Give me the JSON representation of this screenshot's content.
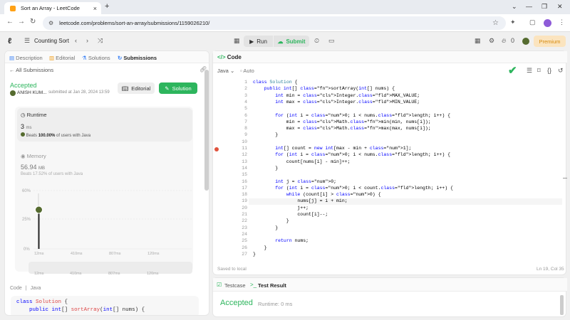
{
  "browser": {
    "tab_title": "Sort an Array - LeetCode",
    "tab_close": "×",
    "new_tab": "+",
    "url": "leetcode.com/problems/sort-an-array/submissions/1159026210/",
    "profile_color": "#8e5bd8"
  },
  "nav": {
    "problem_title": "Counting Sort",
    "run_label": "Run",
    "submit_label": "Submit",
    "coins": "0",
    "premium_label": "Premium"
  },
  "left_panel": {
    "tabs": [
      "Description",
      "Editorial",
      "Solutions",
      "Submissions"
    ],
    "all_submissions": "All Submissions",
    "status": "Accepted",
    "user": "ANISH KUM...",
    "submitted": "submitted at Jan 28, 2024 13:59",
    "editorial_btn": "Editorial",
    "solution_btn": "Solution",
    "runtime_label": "Runtime",
    "runtime_value": "3",
    "runtime_unit": "ms",
    "runtime_beats_pre": "Beats",
    "runtime_beats_pct": "100.00%",
    "runtime_beats_post": "of users with Java",
    "memory_label": "Memory",
    "memory_value": "56.94",
    "memory_unit": "MB",
    "memory_beats": "Beats 17.52% of users with Java",
    "code_header": "Code",
    "code_lang": "Java",
    "code_preview": [
      "class Solution {",
      "    public int[] sortArray(int[] nums) {"
    ]
  },
  "chart_data": {
    "type": "bar",
    "yticks": [
      "60%",
      "25%",
      "0%"
    ],
    "xticks": [
      "12ms",
      "410ms",
      "807ms",
      "120ms"
    ],
    "scrub_ticks": [
      "12ms",
      "410ms",
      "807ms",
      "120ms"
    ],
    "highlight_bar_label": "12ms"
  },
  "editor": {
    "title": "Code",
    "language": "Java",
    "mode": "Auto",
    "lines": [
      "class Solution {",
      "    public int[] sortArray(int[] nums) {",
      "        int min = Integer.MAX_VALUE;",
      "        int max = Integer.MIN_VALUE;",
      "",
      "        for (int i = 0; i < nums.length; i++) {",
      "            min = Math.min(min, nums[i]);",
      "            max = Math.max(max, nums[i]);",
      "        }",
      "",
      "        int[] count = new int[max - min + 1];",
      "        for (int i = 0; i < nums.length; i++) {",
      "            count[nums[i] - min]++;",
      "        }",
      "",
      "        int j = 0;",
      "        for (int i = 0; i < count.length; i++) {",
      "            while (count[i] > 0) {",
      "                nums[j] = i + min;",
      "                j++;",
      "                count[i]--;",
      "            }",
      "        }",
      "",
      "        return nums;",
      "    }",
      "}"
    ],
    "saved": "Saved to local",
    "cursor": "Ln 19, Col 35"
  },
  "test": {
    "testcase_tab": "Testcase",
    "result_tab": "Test Result",
    "status": "Accepted",
    "runtime": "Runtime: 0 ms"
  }
}
